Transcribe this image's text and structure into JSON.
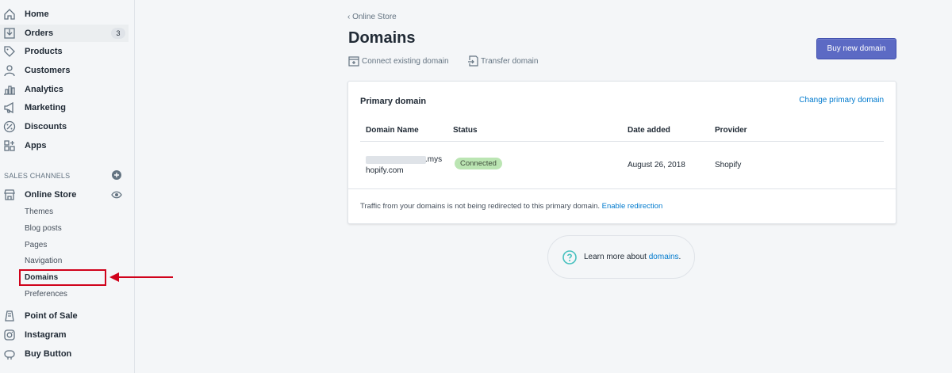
{
  "sidebar": {
    "nav": [
      {
        "label": "Home",
        "icon": "home-icon"
      },
      {
        "label": "Orders",
        "icon": "orders-icon",
        "badge": "3"
      },
      {
        "label": "Products",
        "icon": "tag-icon"
      },
      {
        "label": "Customers",
        "icon": "person-icon"
      },
      {
        "label": "Analytics",
        "icon": "bar-chart-icon"
      },
      {
        "label": "Marketing",
        "icon": "megaphone-icon"
      },
      {
        "label": "Discounts",
        "icon": "discount-icon"
      },
      {
        "label": "Apps",
        "icon": "apps-icon"
      }
    ],
    "sales_channels_heading": "SALES CHANNELS",
    "online_store": {
      "label": "Online Store",
      "sub": [
        "Themes",
        "Blog posts",
        "Pages",
        "Navigation",
        "Domains",
        "Preferences"
      ]
    },
    "other_channels": [
      {
        "label": "Point of Sale",
        "icon": "pos-icon"
      },
      {
        "label": "Instagram",
        "icon": "instagram-icon"
      },
      {
        "label": "Buy Button",
        "icon": "buy-button-icon"
      }
    ]
  },
  "main": {
    "back_label": "Online Store",
    "title": "Domains",
    "connect_label": "Connect existing domain",
    "transfer_label": "Transfer domain",
    "buy_label": "Buy new domain",
    "card": {
      "title": "Primary domain",
      "change_link": "Change primary domain",
      "columns": [
        "Domain Name",
        "Status",
        "Date added",
        "Provider"
      ],
      "row": {
        "domain_line1": ".mys",
        "domain_line2": "hopify.com",
        "status": "Connected",
        "date_added": "August 26, 2018",
        "provider": "Shopify"
      },
      "footer_text": "Traffic from your domains is not being redirected to this primary domain.",
      "footer_link": "Enable redirection"
    },
    "learn_prefix": "Learn more about",
    "learn_link": "domains",
    "learn_suffix": "."
  },
  "colors": {
    "accent": "#5c6ac4",
    "link": "#007ace",
    "status_bg": "#bbe5b3",
    "highlight": "#d0021b"
  }
}
